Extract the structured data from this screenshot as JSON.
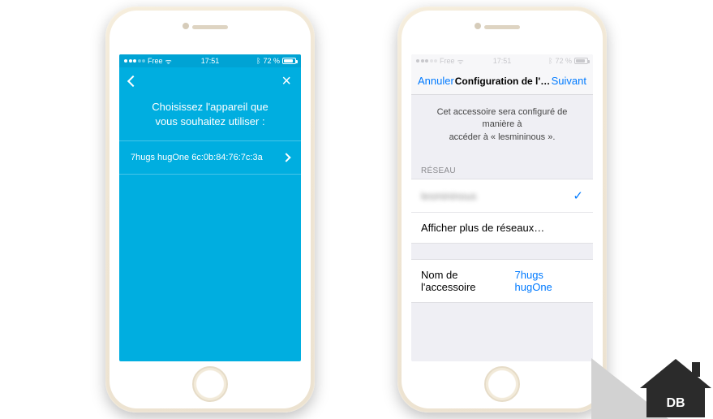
{
  "left": {
    "status": {
      "carrier": "Free",
      "time": "17:51",
      "battery_pct": "72 %",
      "battery_fill": 72
    },
    "instruction_line1": "Choisissez l'appareil que",
    "instruction_line2": "vous souhaitez utiliser :",
    "device_item": "7hugs hugOne 6c:0b:84:76:7c:3a"
  },
  "right": {
    "status": {
      "carrier": "Free",
      "time": "17:51",
      "battery_pct": "72 %",
      "battery_fill": 72
    },
    "nav": {
      "cancel": "Annuler",
      "title": "Configuration de l'acces…",
      "next": "Suivant"
    },
    "message_line1": "Cet accessoire sera configuré de manière à",
    "message_line2": "accéder à « lesmininous ».",
    "section_network": "RÉSEAU",
    "network_selected": "lesmininous",
    "show_more": "Afficher plus de réseaux…",
    "accessory_label": "Nom de l'accessoire",
    "accessory_value": "7hugs hugOne"
  },
  "watermark": {
    "text": "DB"
  }
}
